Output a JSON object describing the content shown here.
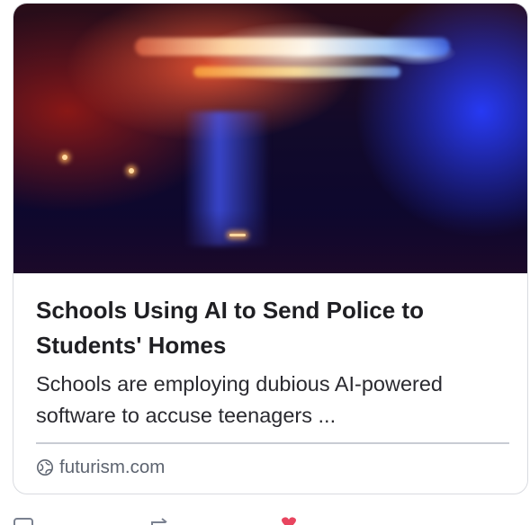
{
  "card": {
    "title": "Schools Using AI to Send Police to Students' Homes",
    "description": "Schools are employing dubious AI-powered software to accuse teenagers ...",
    "source_domain": "futurism.com",
    "image_icon": "globe-icon"
  },
  "actions": {
    "reply_icon": "reply-icon",
    "repost_icon": "repost-icon",
    "like_icon": "heart-icon",
    "like_color": "#e8455f"
  }
}
